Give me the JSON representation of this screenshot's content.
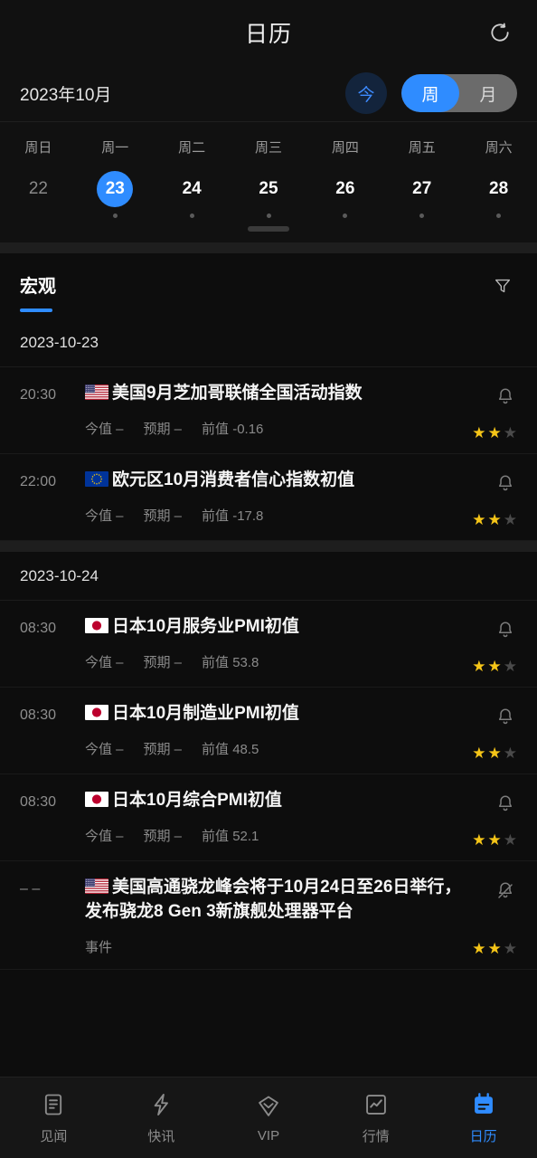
{
  "header": {
    "title": "日历",
    "refresh_icon": "refresh-icon"
  },
  "month_bar": {
    "month_label": "2023年10月",
    "today_label": "今",
    "view_options": [
      {
        "label": "周",
        "active": true
      },
      {
        "label": "月",
        "active": false
      }
    ]
  },
  "week_strip": {
    "weekday_labels": [
      "周日",
      "周一",
      "周二",
      "周三",
      "周四",
      "周五",
      "周六"
    ],
    "days": [
      {
        "num": "22",
        "selected": false,
        "dim": true,
        "has_dot": false
      },
      {
        "num": "23",
        "selected": true,
        "dim": false,
        "has_dot": true
      },
      {
        "num": "24",
        "selected": false,
        "dim": false,
        "has_dot": true
      },
      {
        "num": "25",
        "selected": false,
        "dim": false,
        "has_dot": true
      },
      {
        "num": "26",
        "selected": false,
        "dim": false,
        "has_dot": true
      },
      {
        "num": "27",
        "selected": false,
        "dim": false,
        "has_dot": true
      },
      {
        "num": "28",
        "selected": false,
        "dim": false,
        "has_dot": true
      }
    ]
  },
  "tab_bar": {
    "active_tab": "宏观",
    "filter_icon": "filter-icon"
  },
  "groups": [
    {
      "date": "2023-10-23",
      "events": [
        {
          "time": "20:30",
          "flag": "us-flag",
          "title": "美国9月芝加哥联储全国活动指数",
          "actual_label": "今值",
          "actual_value": "–",
          "forecast_label": "预期",
          "forecast_value": "–",
          "previous_label": "前值",
          "previous_value": "-0.16",
          "bell_icon": "bell-icon",
          "bell_muted": false,
          "stars": 2,
          "max_stars": 3
        },
        {
          "time": "22:00",
          "flag": "eu-flag",
          "title": "欧元区10月消费者信心指数初值",
          "actual_label": "今值",
          "actual_value": "–",
          "forecast_label": "预期",
          "forecast_value": "–",
          "previous_label": "前值",
          "previous_value": "-17.8",
          "bell_icon": "bell-icon",
          "bell_muted": false,
          "stars": 2,
          "max_stars": 3
        }
      ]
    },
    {
      "date": "2023-10-24",
      "events": [
        {
          "time": "08:30",
          "flag": "jp-flag",
          "title": "日本10月服务业PMI初值",
          "actual_label": "今值",
          "actual_value": "–",
          "forecast_label": "预期",
          "forecast_value": "–",
          "previous_label": "前值",
          "previous_value": "53.8",
          "bell_icon": "bell-icon",
          "bell_muted": false,
          "stars": 2,
          "max_stars": 3
        },
        {
          "time": "08:30",
          "flag": "jp-flag",
          "title": "日本10月制造业PMI初值",
          "actual_label": "今值",
          "actual_value": "–",
          "forecast_label": "预期",
          "forecast_value": "–",
          "previous_label": "前值",
          "previous_value": "48.5",
          "bell_icon": "bell-icon",
          "bell_muted": false,
          "stars": 2,
          "max_stars": 3
        },
        {
          "time": "08:30",
          "flag": "jp-flag",
          "title": "日本10月综合PMI初值",
          "actual_label": "今值",
          "actual_value": "–",
          "forecast_label": "预期",
          "forecast_value": "–",
          "previous_label": "前值",
          "previous_value": "52.1",
          "bell_icon": "bell-icon",
          "bell_muted": false,
          "stars": 2,
          "max_stars": 3
        },
        {
          "time": "– –",
          "flag": "us-flag",
          "title": "美国高通骁龙峰会将于10月24日至26日举行，发布骁龙8 Gen 3新旗舰处理器平台",
          "kind_label": "事件",
          "bell_icon": "bell-muted-icon",
          "bell_muted": true,
          "stars": 2,
          "max_stars": 3
        }
      ]
    }
  ],
  "bottom_nav": [
    {
      "label": "见闻",
      "icon": "news-icon",
      "active": false
    },
    {
      "label": "快讯",
      "icon": "flash-icon",
      "active": false
    },
    {
      "label": "VIP",
      "icon": "diamond-icon",
      "active": false
    },
    {
      "label": "行情",
      "icon": "chart-icon",
      "active": false
    },
    {
      "label": "日历",
      "icon": "calendar-icon",
      "active": true
    }
  ],
  "colors": {
    "accent": "#2f8cff",
    "star_on": "#f5c518",
    "star_off": "#4a4a4a",
    "background": "#0d0d0d",
    "surface": "#111111"
  }
}
